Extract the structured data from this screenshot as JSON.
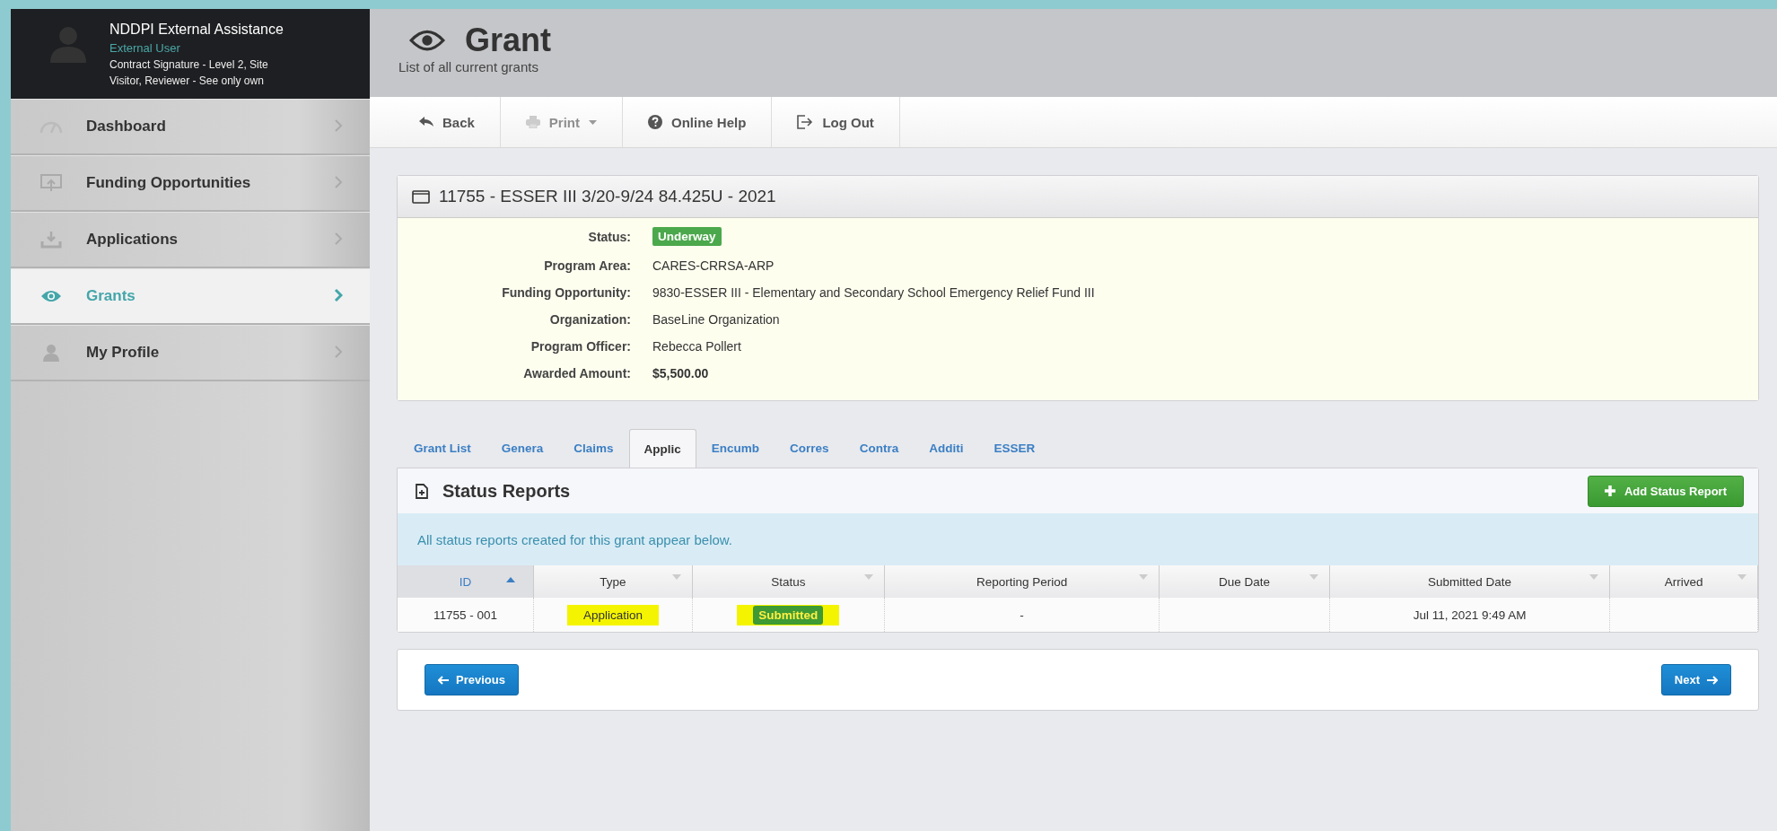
{
  "user": {
    "name": "NDDPI External Assistance",
    "role": "External User",
    "roles_text": "Contract Signature - Level 2, Site",
    "roles_text_2": "Visitor, Reviewer - See only own"
  },
  "sidebar": {
    "items": [
      {
        "label": "Dashboard",
        "selected": false
      },
      {
        "label": "Funding Opportunities",
        "selected": false
      },
      {
        "label": "Applications",
        "selected": false
      },
      {
        "label": "Grants",
        "selected": true
      },
      {
        "label": "My Profile",
        "selected": false
      }
    ]
  },
  "header": {
    "title": "Grant",
    "subtitle": "List of all current grants"
  },
  "toolbar": [
    {
      "label": "Back",
      "disabled": false,
      "dropdown": false
    },
    {
      "label": "Print",
      "disabled": true,
      "dropdown": true
    },
    {
      "label": "Online Help",
      "disabled": false,
      "dropdown": false
    },
    {
      "label": "Log Out",
      "disabled": false,
      "dropdown": false
    }
  ],
  "grant": {
    "title": "11755 - ESSER III 3/20-9/24 84.425U - 2021",
    "fields": [
      {
        "label": "Status:",
        "value": "Underway",
        "kind": "badge"
      },
      {
        "label": "Program Area:",
        "value": "CARES-CRRSA-ARP",
        "kind": "text"
      },
      {
        "label": "Funding Opportunity:",
        "value": "9830-ESSER III - Elementary and Secondary School Emergency Relief Fund III",
        "kind": "text"
      },
      {
        "label": "Organization:",
        "value": "BaseLine Organization",
        "kind": "text"
      },
      {
        "label": "Program Officer:",
        "value": "Rebecca Pollert",
        "kind": "text"
      },
      {
        "label": "Awarded Amount:",
        "value": "$5,500.00",
        "kind": "bold"
      }
    ]
  },
  "tabs": [
    {
      "label": "Grant List",
      "selected": false
    },
    {
      "label": "Genera",
      "selected": false
    },
    {
      "label": "Claims",
      "selected": false
    },
    {
      "label": "Applic",
      "selected": true
    },
    {
      "label": "Encumb",
      "selected": false
    },
    {
      "label": "Corres",
      "selected": false
    },
    {
      "label": "Contra",
      "selected": false
    },
    {
      "label": "Additi",
      "selected": false
    },
    {
      "label": "ESSER",
      "selected": false
    }
  ],
  "status_reports": {
    "title": "Status Reports",
    "add_button": "Add Status Report",
    "info": "All status reports created for this grant appear below.",
    "table": {
      "columns": [
        {
          "label": "ID",
          "sorted": true
        },
        {
          "label": "Type",
          "sorted": false
        },
        {
          "label": "Status",
          "sorted": false
        },
        {
          "label": "Reporting Period",
          "sorted": false
        },
        {
          "label": "Due Date",
          "sorted": false
        },
        {
          "label": "Submitted Date",
          "sorted": false
        },
        {
          "label": "Arrived",
          "sorted": false
        }
      ],
      "rows": [
        {
          "cells": [
            {
              "text": "11755 - 001",
              "kind": "text",
              "highlighted": false
            },
            {
              "text": "Application",
              "kind": "text",
              "highlighted": true
            },
            {
              "text": "Submitted",
              "kind": "badge",
              "highlighted": true
            },
            {
              "text": "-",
              "kind": "text",
              "highlighted": false
            },
            {
              "kind": "empty"
            },
            {
              "text": "Jul 11, 2021 9:49 AM",
              "kind": "text",
              "highlighted": false
            },
            {
              "kind": "empty"
            }
          ]
        }
      ]
    }
  },
  "pager": {
    "previous": "Previous",
    "next": "Next"
  }
}
